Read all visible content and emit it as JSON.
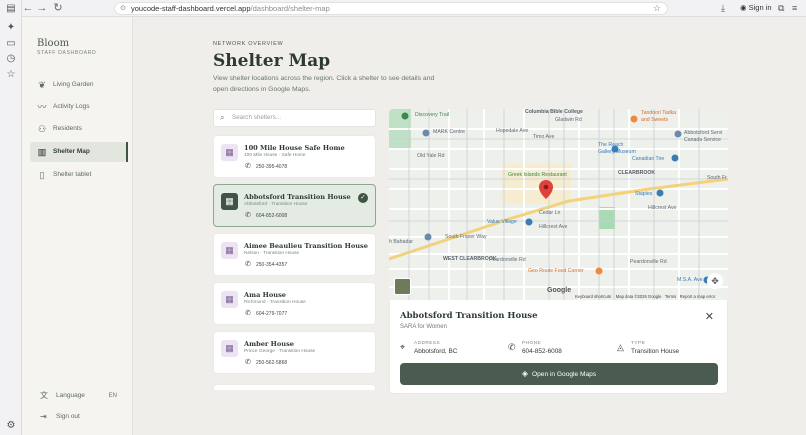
{
  "browser": {
    "url_host": "youcode-staff-dashboard.vercel.app",
    "url_path": "/dashboard/shelter-map",
    "sign_in": "Sign in"
  },
  "sidebar": {
    "brand": "Bloom",
    "brand_sub": "STAFF DASHBOARD",
    "items": [
      {
        "label": "Living Garden",
        "icon": "leaf-icon"
      },
      {
        "label": "Activity Logs",
        "icon": "activity-icon"
      },
      {
        "label": "Residents",
        "icon": "users-icon"
      },
      {
        "label": "Shelter Map",
        "icon": "map-icon",
        "active": true
      },
      {
        "label": "Shelter tablet",
        "icon": "tablet-icon"
      }
    ],
    "language_label": "Language",
    "language_code": "EN",
    "sign_out": "Sign out"
  },
  "header": {
    "eyebrow": "NETWORK OVERVIEW",
    "title": "Shelter Map",
    "subtitle": "View shelter locations across the region. Click a shelter to see details and open directions in Google Maps."
  },
  "search": {
    "placeholder": "Search shelters..."
  },
  "shelters": [
    {
      "name": "100 Mile House Safe Home",
      "meta": "100 Mile House · Safe Home",
      "phone": "250-395-4078"
    },
    {
      "name": "Abbotsford Transition House",
      "meta": "Abbotsford · Transition House",
      "phone": "604-852-6008",
      "selected": true
    },
    {
      "name": "Aimee Beaulieu Transition House",
      "meta": "Nelson · Transition House",
      "phone": "250-354-4357"
    },
    {
      "name": "Ama House",
      "meta": "Richmond · Transition House",
      "phone": "604-279-7077"
    },
    {
      "name": "Amber House",
      "meta": "Prince George · Transition House",
      "phone": "250-562-5868"
    }
  ],
  "map": {
    "labels": {
      "discovery_trail": "Discovery Trail",
      "columbia": "Columbia Bible College",
      "tandoori": "Tandoori Tadka",
      "tandoori2": "and Sweets",
      "mark": "MARK Centre",
      "hopedale": "Hopedale Ave",
      "timo": "Timo Ave",
      "gladwin": "Gladwin Rd",
      "abbotsford_service": "Abbotsford Servi",
      "canada_service": "Canada Service",
      "old_yale": "Old Yale Rd",
      "reach1": "The Reach",
      "reach2": "Gallery Museum",
      "canadian_tire": "Canadian Tire",
      "clearbrook": "CLEARBROOK",
      "greek_islands": "Greek Islands Restaurant",
      "south_fr": "South Fr",
      "staples": "Staples",
      "hillcrest_ave": "Hillcrest Ave",
      "value_village": "Value Village",
      "bahadar": "h Bahadar",
      "south_fraser_way": "South Fraser Way",
      "west_clearbrook": "WEST CLEARBROOK",
      "peardonville": "Peardonville Rd",
      "geo_route": "Geo Route Food Corner",
      "msa": "M.S.A. Ave",
      "cedar": "Cedar Ln"
    },
    "attribution": {
      "shortcuts": "Keyboard shortcuts",
      "data": "Map data ©2026 Google",
      "terms": "Terms",
      "report": "Report a map error",
      "google": "Google"
    }
  },
  "detail": {
    "name": "Abbotsford Transition House",
    "subtitle": "SARA for Women",
    "address_label": "ADDRESS",
    "address": "Abbotsford, BC",
    "phone_label": "PHONE",
    "phone": "604-852-6008",
    "type_label": "TYPE",
    "type": "Transition House",
    "button": "Open in Google Maps"
  }
}
